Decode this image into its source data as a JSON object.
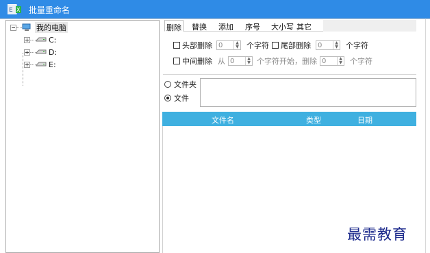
{
  "window": {
    "title": "批量重命名"
  },
  "tree": {
    "root_label": "我的电脑",
    "drives": [
      "C:",
      "D:",
      "E:"
    ]
  },
  "tabs": [
    "删除",
    "替换",
    "添加",
    "序号",
    "大小写",
    "其它"
  ],
  "delete_panel": {
    "head_delete": {
      "label": "头部删除",
      "value": "0",
      "unit": "个字符"
    },
    "tail_delete": {
      "label": "尾部删除",
      "value": "0",
      "unit": "个字符"
    },
    "middle_delete": {
      "label": "中间删除",
      "from_label": "从",
      "from_value": "0",
      "start_text": "个字符开始，删除",
      "count_value": "0",
      "unit": "个字符"
    }
  },
  "target": {
    "folder_label": "文件夹",
    "file_label": "文件",
    "selected": "文件"
  },
  "file_list": {
    "columns": [
      "文件名",
      "类型",
      "日期"
    ]
  },
  "watermark": "最需教育",
  "colors": {
    "titlebar": "#2f8be6",
    "list_header": "#3fb0e0",
    "watermark": "#1c2a8c"
  }
}
